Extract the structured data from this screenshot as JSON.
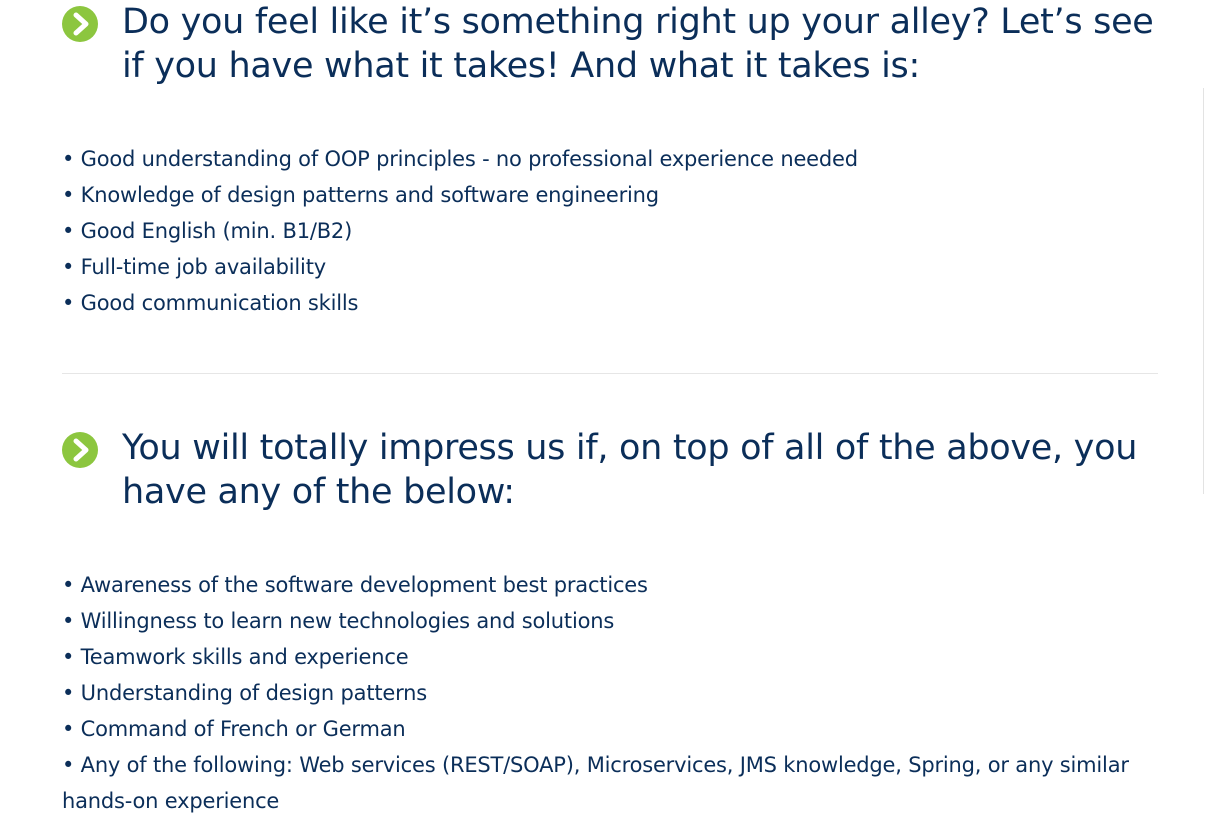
{
  "sections": [
    {
      "icon": "chevron-right-circle-icon",
      "heading": "Do you feel like it’s something right up your alley? Let’s see if you have what it takes! And what it takes is:",
      "items": [
        "• Good understanding of OOP principles - no professional experience needed",
        "• Knowledge of design patterns and software engineering",
        "• Good English (min. B1/B2)",
        "• Full-time job availability",
        "• Good communication skills"
      ]
    },
    {
      "icon": "chevron-right-circle-icon",
      "heading": "You will totally impress us if, on top of all of the above, you have any of the below:",
      "items": [
        "• Awareness of the software development best practices",
        "• Willingness to learn new technologies and solutions",
        "• Teamwork skills and experience",
        "• Understanding of design patterns",
        "• Command of French or German",
        "• Any of the following: Web services (REST/SOAP), Microservices, JMS knowledge, Spring, or any similar hands-on experience"
      ]
    }
  ],
  "colors": {
    "text": "#0b2e59",
    "icon_fill": "#8cc63f",
    "divider": "#e6e6e6"
  }
}
